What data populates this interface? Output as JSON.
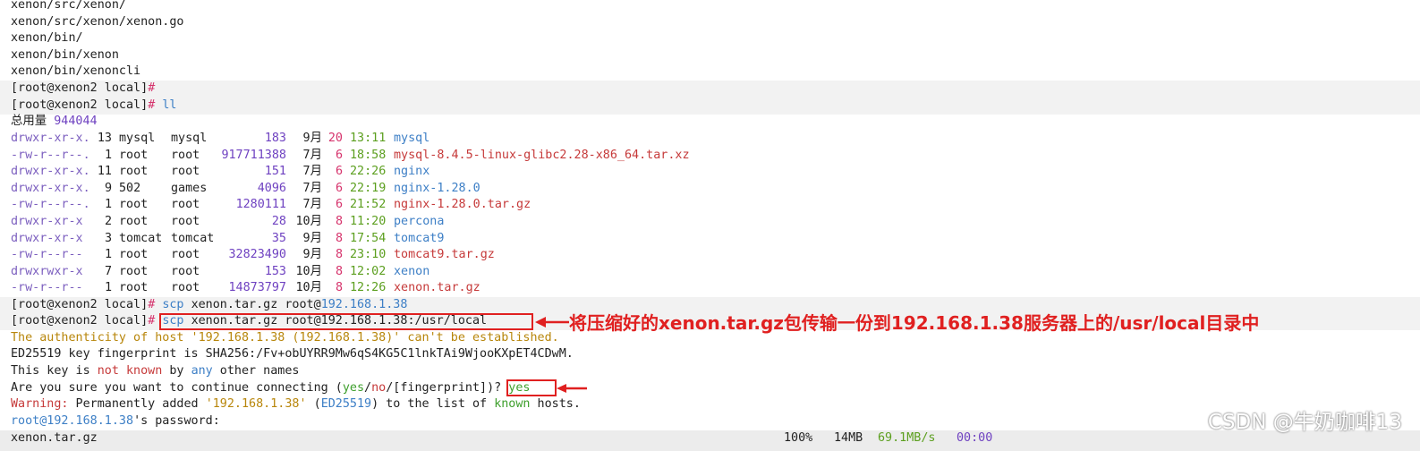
{
  "history_lines": [
    "xenon/src/xenon/",
    "xenon/src/xenon/xenon.go",
    "xenon/bin/",
    "xenon/bin/xenon",
    "xenon/bin/xenoncli"
  ],
  "prompt": "[root@xenon2 local]",
  "prompt_hash": "#",
  "cmd_ll": "ll",
  "total_label": "总用量",
  "total_value": "944044",
  "listing": [
    {
      "perm": "drwxr-xr-x.",
      "links": "13",
      "owner": "mysql",
      "group": "mysql",
      "size": "183",
      "month": "9月",
      "day": "20",
      "time": "13:11",
      "name": "mysql",
      "kind": "dir"
    },
    {
      "perm": "-rw-r--r--.",
      "links": "1",
      "owner": "root",
      "group": "root",
      "size": "917711388",
      "month": "7月",
      "day": "6",
      "time": "18:58",
      "name": "mysql-8.4.5-linux-glibc2.28-x86_64.tar.xz",
      "kind": "archive"
    },
    {
      "perm": "drwxr-xr-x.",
      "links": "11",
      "owner": "root",
      "group": "root",
      "size": "151",
      "month": "7月",
      "day": "6",
      "time": "22:26",
      "name": "nginx",
      "kind": "dir"
    },
    {
      "perm": "drwxr-xr-x.",
      "links": "9",
      "owner": "502",
      "group": "games",
      "size": "4096",
      "month": "7月",
      "day": "6",
      "time": "22:19",
      "name": "nginx-1.28.0",
      "kind": "dir"
    },
    {
      "perm": "-rw-r--r--.",
      "links": "1",
      "owner": "root",
      "group": "root",
      "size": "1280111",
      "month": "7月",
      "day": "6",
      "time": "21:52",
      "name": "nginx-1.28.0.tar.gz",
      "kind": "archive"
    },
    {
      "perm": "drwxr-xr-x",
      "links": "2",
      "owner": "root",
      "group": "root",
      "size": "28",
      "month": "10月",
      "day": "8",
      "time": "11:20",
      "name": "percona",
      "kind": "dir"
    },
    {
      "perm": "drwxr-xr-x",
      "links": "3",
      "owner": "tomcat",
      "group": "tomcat",
      "size": "35",
      "month": "9月",
      "day": "8",
      "time": "17:54",
      "name": "tomcat9",
      "kind": "dir"
    },
    {
      "perm": "-rw-r--r--",
      "links": "1",
      "owner": "root",
      "group": "root",
      "size": "32823490",
      "month": "9月",
      "day": "8",
      "time": "23:10",
      "name": "tomcat9.tar.gz",
      "kind": "archive"
    },
    {
      "perm": "drwxrwxr-x",
      "links": "7",
      "owner": "root",
      "group": "root",
      "size": "153",
      "month": "10月",
      "day": "8",
      "time": "12:02",
      "name": "xenon",
      "kind": "dir"
    },
    {
      "perm": "-rw-r--r--",
      "links": "1",
      "owner": "root",
      "group": "root",
      "size": "14873797",
      "month": "10月",
      "day": "8",
      "time": "12:26",
      "name": "xenon.tar.gz",
      "kind": "archive"
    }
  ],
  "scp_partial": {
    "cmd": "scp",
    "args": "xenon.tar.gz",
    "target": "root@",
    "host": "192.168.1.38"
  },
  "scp_full": {
    "cmd": "scp",
    "args": "xenon.tar.gz",
    "target": "root@192.168.1.38",
    "path": ":/usr/local"
  },
  "auth_line": "The authenticity of host '192.168.1.38 (192.168.1.38)' can't be established.",
  "fingerprint_line": "ED25519 key fingerprint is SHA256:/Fv+obUYRR9Mw6qS4KG5C1lnkTAi9WjooKXpET4CDwM.",
  "key_line": {
    "a": "This key is ",
    "b": "not known",
    "c": " by ",
    "d": "any",
    "e": " other names"
  },
  "confirm_line": {
    "a": "Are you sure you want to continue connecting (",
    "yes": "yes",
    "s1": "/",
    "no": "no",
    "s2": "/",
    "fp": "[fingerprint]",
    "b": ")? ",
    "answer": "yes"
  },
  "warning_line": {
    "label": "Warning:",
    "a": " Permanently added ",
    "host": "'192.168.1.38'",
    "b": " (",
    "alg": "ED25519",
    "c": ") to the list of ",
    "known": "known",
    "d": " hosts."
  },
  "password_line": {
    "user": "root@192.168.1.38",
    "rest": "'s password:"
  },
  "progress": {
    "file": "xenon.tar.gz",
    "percent": "100%",
    "size": "14MB",
    "rate": "69.1MB/s",
    "eta": "00:00"
  },
  "annotations": {
    "scp_note_parts": [
      "将压缩好的",
      "xenon.tar.gz",
      "包传输一份到",
      "192.168.1.38",
      "服务器上的",
      "/usr/local",
      "目录中"
    ]
  },
  "watermark": "CSDN @牛奶咖啡13",
  "colors": {
    "annotation_red": "#e02020",
    "prompt_pink": "#d6336c",
    "dir_blue": "#3d7fc6",
    "archive_red": "#c63a3a"
  }
}
